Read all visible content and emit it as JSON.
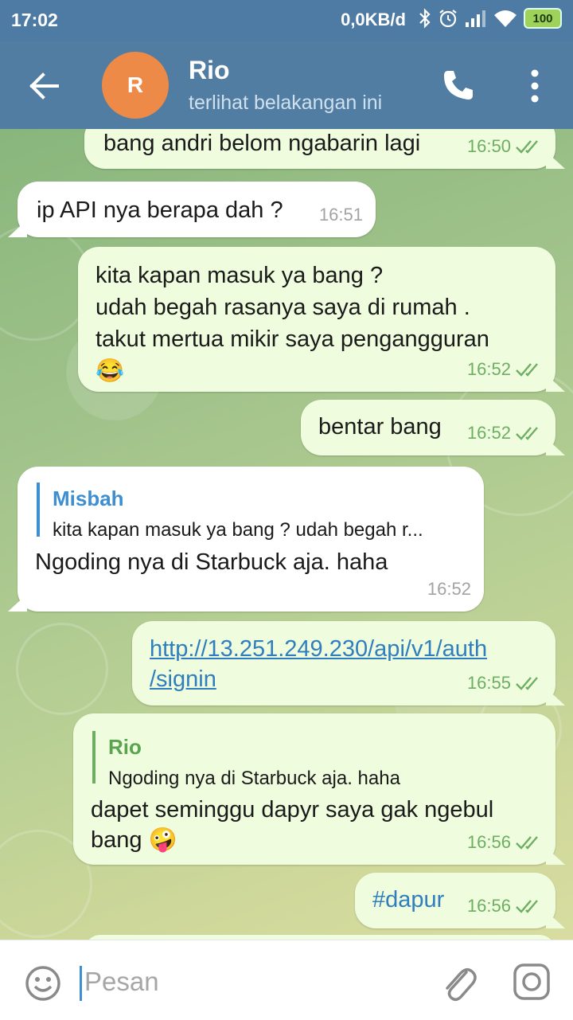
{
  "status_bar": {
    "time": "17:02",
    "network_speed": "0,0KB/d",
    "battery": "100"
  },
  "header": {
    "avatar_initial": "R",
    "name": "Rio",
    "status": "terlihat belakangan ini"
  },
  "messages": [
    {
      "dir": "out",
      "text": "bang andri belom ngabarin lagi",
      "time": "16:50"
    },
    {
      "dir": "in",
      "text": "ip API nya berapa dah ?",
      "time": "16:51"
    },
    {
      "dir": "out",
      "text": "kita kapan masuk ya bang ?\nudah begah rasanya saya di rumah .\ntakut mertua mikir saya pengangguran\n😂",
      "time": "16:52"
    },
    {
      "dir": "out",
      "text": "bentar bang",
      "time": "16:52"
    },
    {
      "dir": "in",
      "reply_name": "Misbah",
      "reply_text": "kita kapan masuk ya bang ? udah begah r...",
      "text": "Ngoding nya di Starbuck aja. haha",
      "time": "16:52"
    },
    {
      "dir": "out",
      "text": "http://13.251.249.230/api/v1/auth\n/signin",
      "time": "16:55"
    },
    {
      "dir": "out",
      "reply_name": "Rio",
      "reply_text": "Ngoding nya di Starbuck aja. haha",
      "text": "dapet seminggu dapyr saya gak ngebul\nbang 🤪",
      "time": "16:56"
    },
    {
      "dir": "out",
      "text": "#dapur",
      "time": "16:56"
    }
  ],
  "composer": {
    "placeholder": "Pesan"
  },
  "colors": {
    "header": "#517da2",
    "outgoing_bubble": "#effdde",
    "incoming_bubble": "#ffffff",
    "link": "#2f7ebd",
    "read_ticks": "#6dae63"
  }
}
